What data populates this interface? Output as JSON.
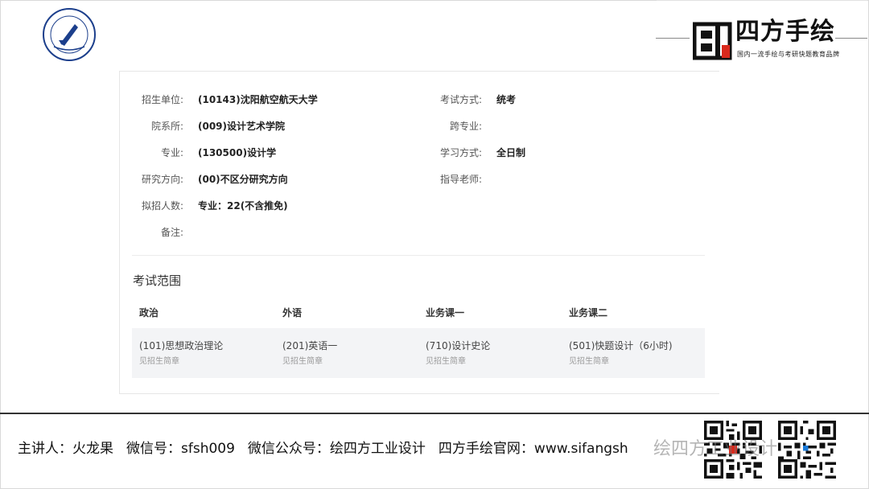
{
  "university_logo": {
    "icon": "university-seal-icon"
  },
  "brand": {
    "name": "四方手绘",
    "slogan": "国内一流手绘与考研快题教育品牌",
    "icon": "sifang-logo-icon"
  },
  "info_left": [
    {
      "label": "招生单位:",
      "value": "(10143)沈阳航空航天大学"
    },
    {
      "label": "院系所:",
      "value": "(009)设计艺术学院"
    },
    {
      "label": "专业:",
      "value": "(130500)设计学"
    },
    {
      "label": "研究方向:",
      "value": "(00)不区分研究方向"
    },
    {
      "label": "拟招人数:",
      "value": "专业：22(不含推免)"
    },
    {
      "label": "备注:",
      "value": ""
    }
  ],
  "info_right": [
    {
      "label": "考试方式:",
      "value": "统考"
    },
    {
      "label": "跨专业:",
      "value": ""
    },
    {
      "label": "学习方式:",
      "value": "全日制"
    },
    {
      "label": "指导老师:",
      "value": ""
    }
  ],
  "exam_scope": {
    "title": "考试范围",
    "columns": [
      "政治",
      "外语",
      "业务课一",
      "业务课二"
    ],
    "subjects": [
      {
        "name": "(101)思想政治理论",
        "note": "见招生简章"
      },
      {
        "name": "(201)英语一",
        "note": "见招生简章"
      },
      {
        "name": "(710)设计史论",
        "note": "见招生简章"
      },
      {
        "name": "(501)快题设计（6小时)",
        "note": "见招生简章"
      }
    ]
  },
  "footer": {
    "lecturer": "主讲人：火龙果",
    "wechat": "微信号：sfsh009",
    "official_account": "微信公众号：绘四方工业设计",
    "website": "四方手绘官网：www.sifangsh",
    "watermark": "绘四方工业设计"
  },
  "colors": {
    "accent_red": "#d9291c",
    "text_dark": "#222222",
    "row_bg": "#f3f4f6"
  }
}
